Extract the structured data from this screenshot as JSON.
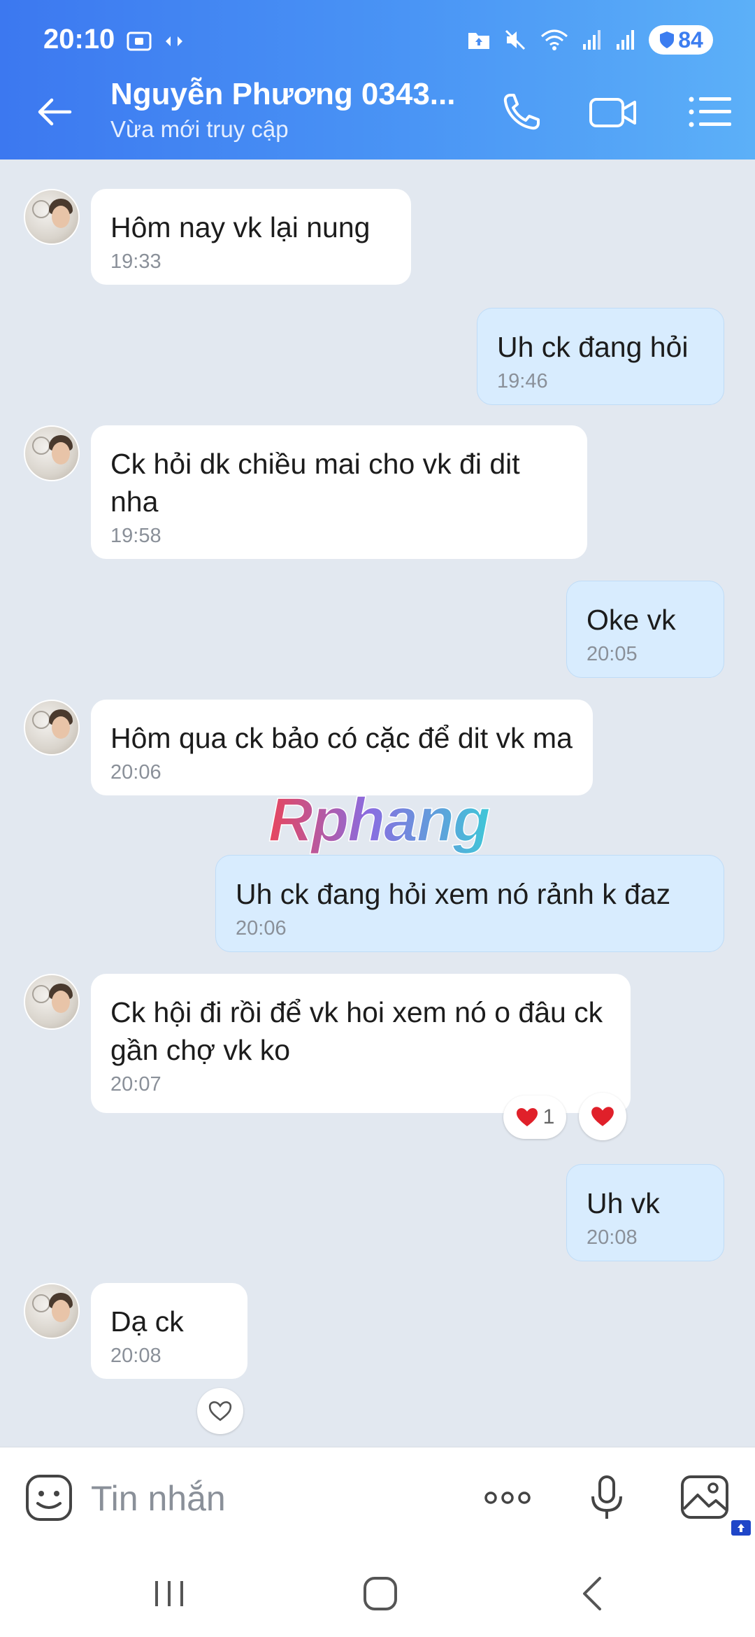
{
  "status_bar": {
    "time": "20:10",
    "battery": "84"
  },
  "header": {
    "contact_name": "Nguyễn Phương 0343...",
    "contact_status": "Vừa mới truy cập",
    "icons": [
      "back-arrow-icon",
      "phone-icon",
      "video-call-icon",
      "menu-list-icon"
    ]
  },
  "messages": [
    {
      "direction": "in",
      "text": "Hôm nay vk lại nung",
      "time": "19:33"
    },
    {
      "direction": "out",
      "text": "Uh ck đang hỏi",
      "time": "19:46"
    },
    {
      "direction": "in",
      "text": "Ck hỏi dk chiều mai cho vk đi dit nha",
      "time": "19:58"
    },
    {
      "direction": "out",
      "text": "Oke vk",
      "time": "20:05"
    },
    {
      "direction": "in",
      "text": "Hôm qua ck bảo có cặc để dit vk ma",
      "time": "20:06"
    },
    {
      "direction": "out",
      "text": "Uh ck đang hỏi xem nó rảnh k đaz",
      "time": "20:06"
    },
    {
      "direction": "in",
      "text": "Ck hội đi rồi để vk hoi xem nó o đâu ck gần chợ vk ko",
      "time": "20:07",
      "reaction_count": "1"
    },
    {
      "direction": "out",
      "text": "Uh vk",
      "time": "20:08"
    },
    {
      "direction": "in",
      "text": "Dạ ck",
      "time": "20:08"
    }
  ],
  "watermark": "Rphang",
  "input": {
    "placeholder": "Tin nhắn"
  },
  "colors": {
    "header_start": "#3c78f0",
    "header_end": "#5cb0f8",
    "outgoing_bubble": "#d8ecfe",
    "chat_bg": "#e2e8f0",
    "heart": "#e0202a"
  }
}
